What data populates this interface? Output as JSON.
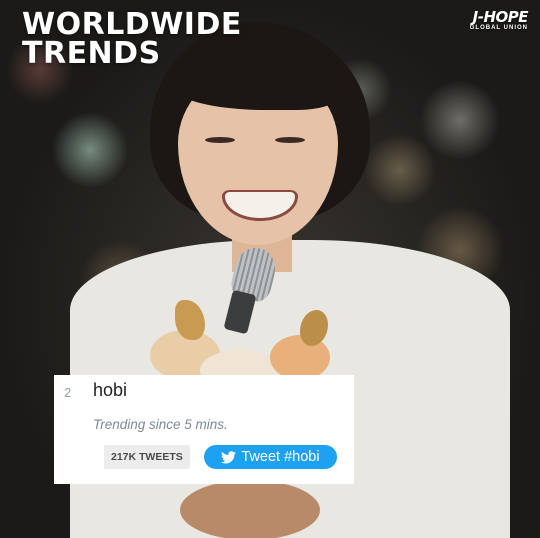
{
  "headline": {
    "line1": "WORLDWIDE",
    "line2": "TRENDS"
  },
  "brand": {
    "name": "J-HOPE",
    "subtitle": "GLOBAL UNION"
  },
  "trend_card": {
    "rank": "2",
    "term": "hobi",
    "since": "Trending since 5 mins.",
    "tweet_count": "217K TWEETS",
    "button_label": "Tweet #hobi",
    "button_icon": "twitter-bird-icon",
    "button_color": "#1da1f2"
  },
  "photo": {
    "subject": "smiling performer with microphone and flower bouquet"
  }
}
